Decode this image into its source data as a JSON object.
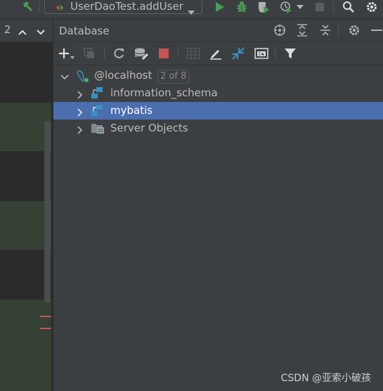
{
  "toolbar": {
    "run_config": "UserDaoTest.addUser"
  },
  "editor": {
    "match_count": "2"
  },
  "database_panel": {
    "title": "Database",
    "tree": [
      {
        "label": "@localhost",
        "badge": "2 of 8",
        "expanded": true,
        "selected": false,
        "icon": "datasource-icon"
      },
      {
        "label": "information_schema",
        "expanded": false,
        "selected": false,
        "icon": "schema-icon"
      },
      {
        "label": "mybatis",
        "expanded": false,
        "selected": true,
        "icon": "schema-icon"
      },
      {
        "label": "Server Objects",
        "expanded": false,
        "selected": false,
        "icon": "server-objects-icon"
      }
    ]
  },
  "watermark": "CSDN @亚索小破孩",
  "colors": {
    "panel_bg": "#3c3f41",
    "editor_bg": "#2b2b2b",
    "selection": "#4b6eaf",
    "run_green": "#499c54",
    "stop_red": "#c75450",
    "schema_blue": "#3592c4"
  }
}
